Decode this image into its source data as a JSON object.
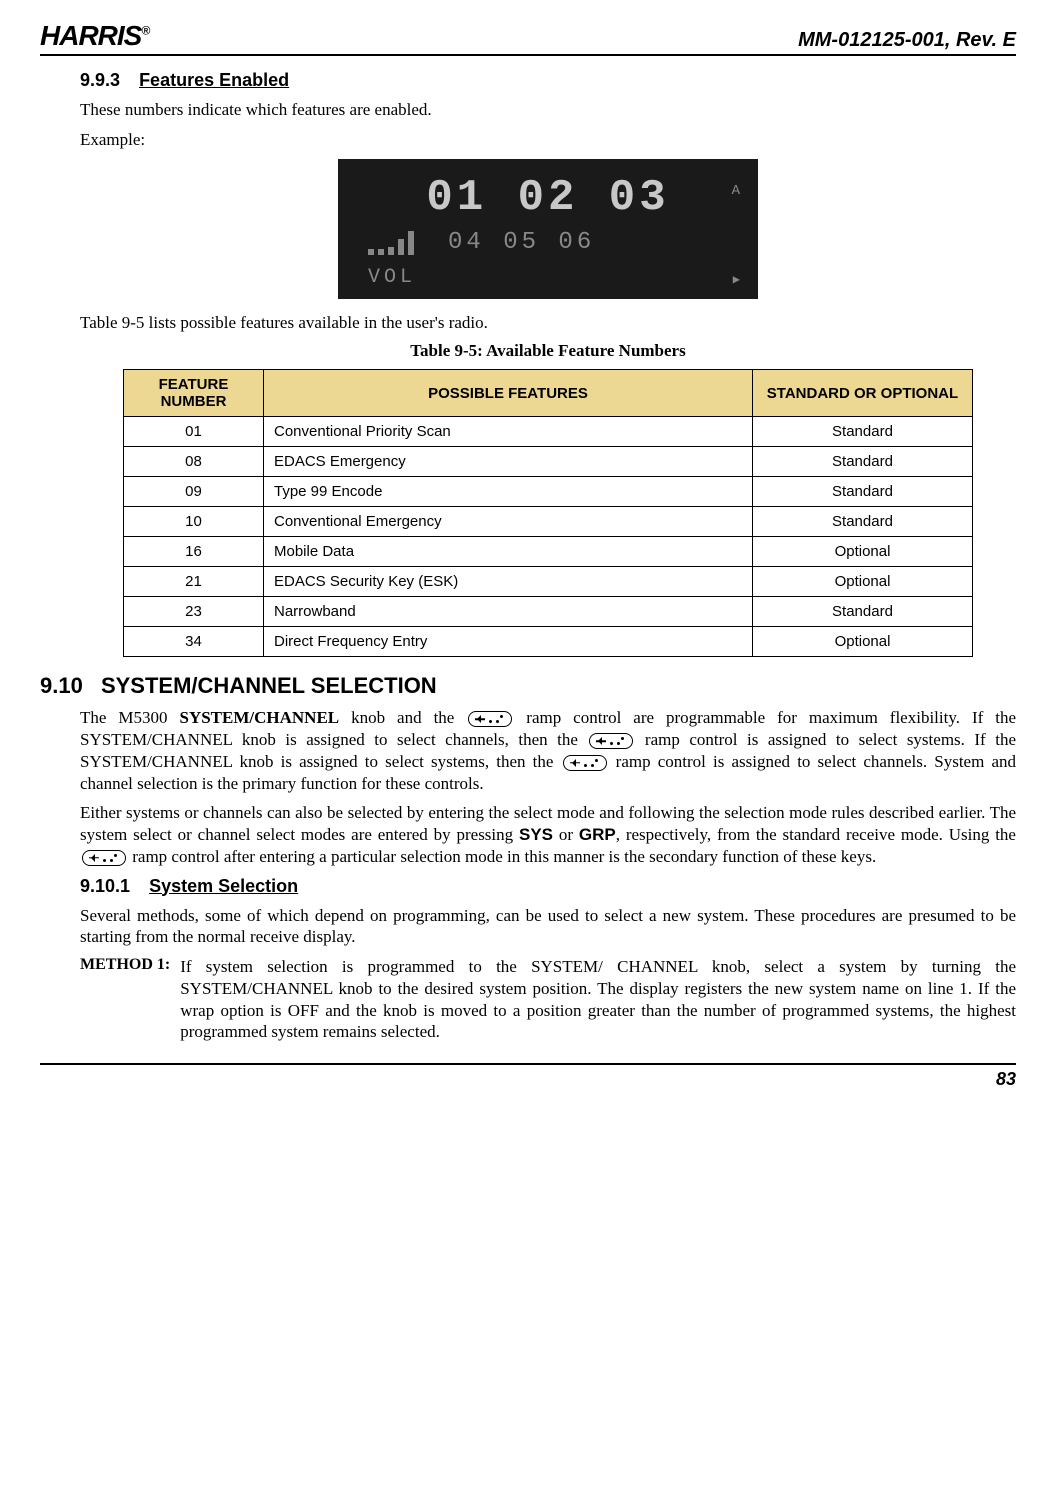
{
  "header": {
    "logo": "HARRIS",
    "doc_id": "MM-012125-001, Rev. E"
  },
  "s993": {
    "number": "9.9.3",
    "title": "Features Enabled",
    "p1": "These numbers indicate which features are enabled.",
    "p2": "Example:",
    "display": {
      "top": "01  02  03",
      "mid": "04 05 06",
      "vol": "VOL",
      "a": "A",
      "play": "▶"
    },
    "p3": "Table 9-5 lists possible features available in the user's radio.",
    "caption": "Table 9-5: Available Feature Numbers"
  },
  "table": {
    "headers": {
      "c1": "FEATURE NUMBER",
      "c2": "POSSIBLE FEATURES",
      "c3": "STANDARD OR OPTIONAL"
    },
    "rows": [
      {
        "num": "01",
        "feat": "Conventional Priority Scan",
        "so": "Standard"
      },
      {
        "num": "08",
        "feat": "EDACS Emergency",
        "so": "Standard"
      },
      {
        "num": "09",
        "feat": "Type 99 Encode",
        "so": "Standard"
      },
      {
        "num": "10",
        "feat": "Conventional Emergency",
        "so": "Standard"
      },
      {
        "num": "16",
        "feat": "Mobile Data",
        "so": "Optional"
      },
      {
        "num": "21",
        "feat": "EDACS Security Key (ESK)",
        "so": "Optional"
      },
      {
        "num": "23",
        "feat": "Narrowband",
        "so": "Standard"
      },
      {
        "num": "34",
        "feat": "Direct Frequency Entry",
        "so": "Optional"
      }
    ]
  },
  "s910": {
    "number": "9.10",
    "title": "SYSTEM/CHANNEL SELECTION",
    "p1a": "The M5300 ",
    "p1b": "SYSTEM/CHANNEL",
    "p1c": " knob and the ",
    "p1d": " ramp control are programmable for maximum flexibility. If the SYSTEM/CHANNEL knob is assigned to select channels, then the ",
    "p1e": " ramp control is assigned to select systems. If the SYSTEM/CHANNEL knob is assigned to select systems, then the ",
    "p1f": " ramp control is assigned to select channels. System and channel selection is the primary function for these controls.",
    "p2a": "Either systems or channels can also be selected by entering the select mode and following the selection mode rules described earlier. The system select or channel select modes are entered by pressing ",
    "p2_sys": "SYS",
    "p2b": " or ",
    "p2_grp": "GRP",
    "p2c": ", respectively, from the standard receive mode. Using the ",
    "p2d": " ramp control after entering a particular selection mode in this manner is the secondary function of these keys."
  },
  "s9101": {
    "number": "9.10.1",
    "title": "System Selection",
    "p1": "Several methods, some of which depend on programming, can be used to select a new system. These procedures are presumed to be starting from the normal receive display.",
    "method_label": "METHOD 1:",
    "method_body": "If system selection is programmed to the SYSTEM/ CHANNEL knob, select a system by turning the SYSTEM/CHANNEL knob to the desired system position. The display registers the new system name on line 1. If the wrap option is OFF and the knob is moved to a position greater than the number of programmed systems, the highest programmed system remains selected."
  },
  "footer": {
    "page": "83"
  }
}
